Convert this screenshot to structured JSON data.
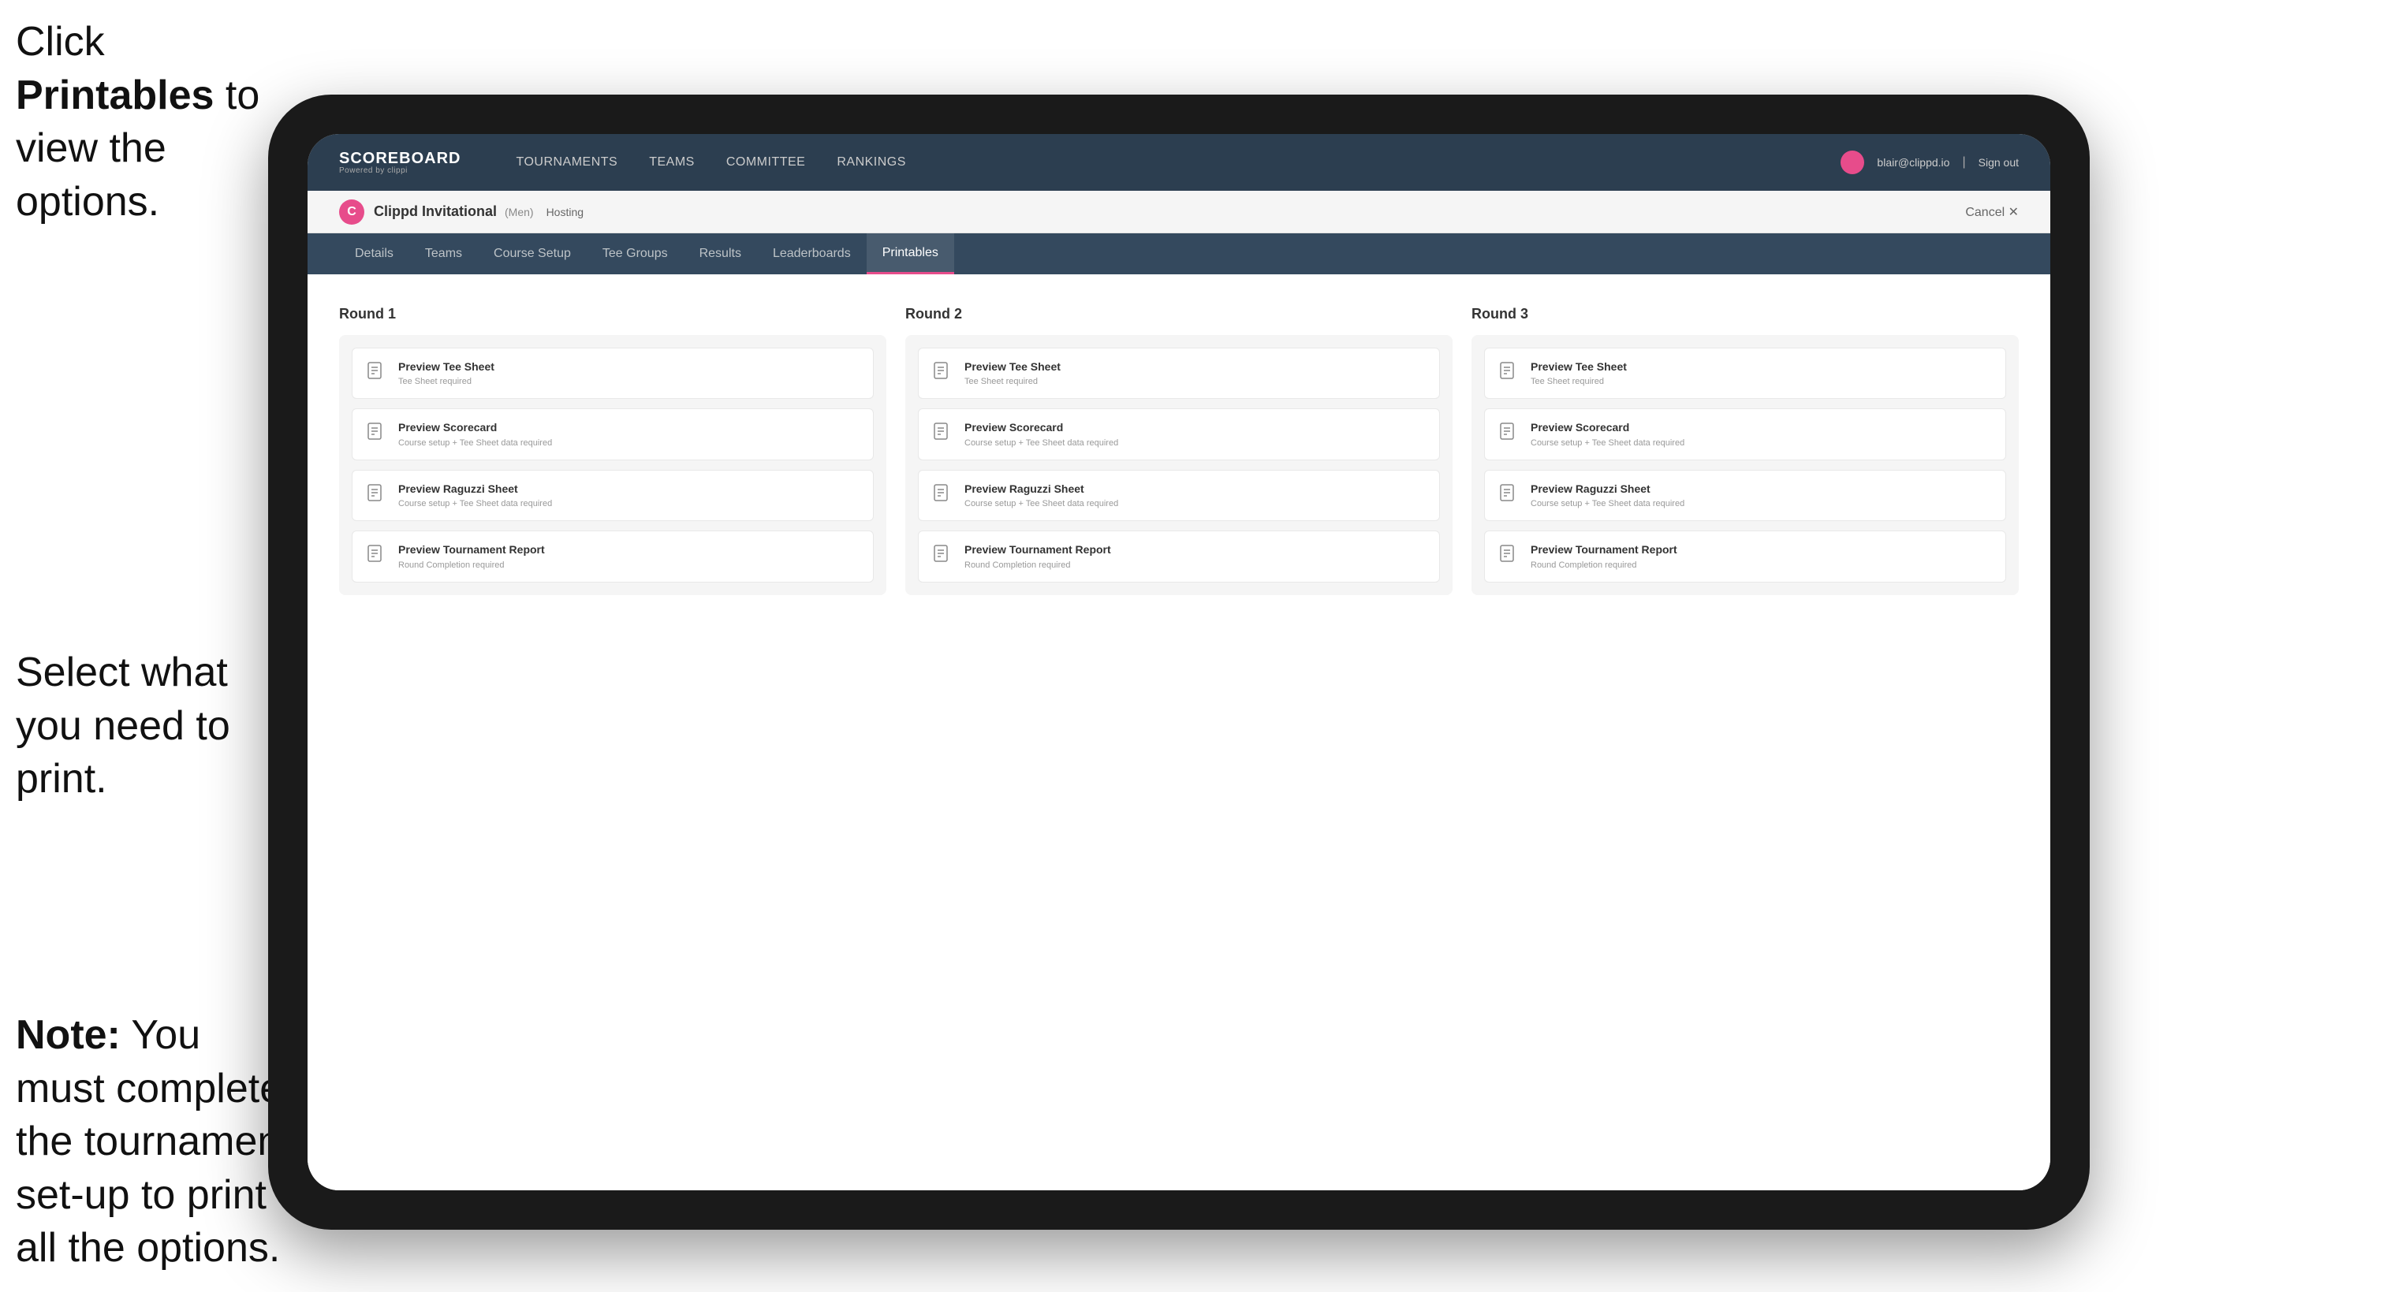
{
  "annotations": {
    "top": "Click Printables to view the options.",
    "top_bold": "Printables",
    "middle": "Select what you need to print.",
    "bottom_note": "Note:",
    "bottom": " You must complete the tournament set-up to print all the options."
  },
  "topNav": {
    "logo": "SCOREBOARD",
    "logo_sub": "Powered by clippi",
    "links": [
      {
        "label": "TOURNAMENTS",
        "active": false
      },
      {
        "label": "TEAMS",
        "active": false
      },
      {
        "label": "COMMITTEE",
        "active": false
      },
      {
        "label": "RANKINGS",
        "active": false
      }
    ],
    "user_email": "blair@clippd.io",
    "sign_out": "Sign out"
  },
  "tournament": {
    "logo_letter": "C",
    "name": "Clippd Invitational",
    "type": "(Men)",
    "status": "Hosting",
    "cancel": "Cancel ✕"
  },
  "subNav": {
    "tabs": [
      {
        "label": "Details",
        "active": false
      },
      {
        "label": "Teams",
        "active": false
      },
      {
        "label": "Course Setup",
        "active": false
      },
      {
        "label": "Tee Groups",
        "active": false
      },
      {
        "label": "Results",
        "active": false
      },
      {
        "label": "Leaderboards",
        "active": false
      },
      {
        "label": "Printables",
        "active": true
      }
    ]
  },
  "rounds": [
    {
      "title": "Round 1",
      "cards": [
        {
          "name": "preview-tee-sheet-r1",
          "title": "Preview Tee Sheet",
          "subtitle": "Tee Sheet required"
        },
        {
          "name": "preview-scorecard-r1",
          "title": "Preview Scorecard",
          "subtitle": "Course setup + Tee Sheet data required"
        },
        {
          "name": "preview-raguzzi-r1",
          "title": "Preview Raguzzi Sheet",
          "subtitle": "Course setup + Tee Sheet data required"
        },
        {
          "name": "preview-tournament-r1",
          "title": "Preview Tournament Report",
          "subtitle": "Round Completion required"
        }
      ]
    },
    {
      "title": "Round 2",
      "cards": [
        {
          "name": "preview-tee-sheet-r2",
          "title": "Preview Tee Sheet",
          "subtitle": "Tee Sheet required"
        },
        {
          "name": "preview-scorecard-r2",
          "title": "Preview Scorecard",
          "subtitle": "Course setup + Tee Sheet data required"
        },
        {
          "name": "preview-raguzzi-r2",
          "title": "Preview Raguzzi Sheet",
          "subtitle": "Course setup + Tee Sheet data required"
        },
        {
          "name": "preview-tournament-r2",
          "title": "Preview Tournament Report",
          "subtitle": "Round Completion required"
        }
      ]
    },
    {
      "title": "Round 3",
      "cards": [
        {
          "name": "preview-tee-sheet-r3",
          "title": "Preview Tee Sheet",
          "subtitle": "Tee Sheet required"
        },
        {
          "name": "preview-scorecard-r3",
          "title": "Preview Scorecard",
          "subtitle": "Course setup + Tee Sheet data required"
        },
        {
          "name": "preview-raguzzi-r3",
          "title": "Preview Raguzzi Sheet",
          "subtitle": "Course setup + Tee Sheet data required"
        },
        {
          "name": "preview-tournament-r3",
          "title": "Preview Tournament Report",
          "subtitle": "Round Completion required"
        }
      ]
    }
  ]
}
